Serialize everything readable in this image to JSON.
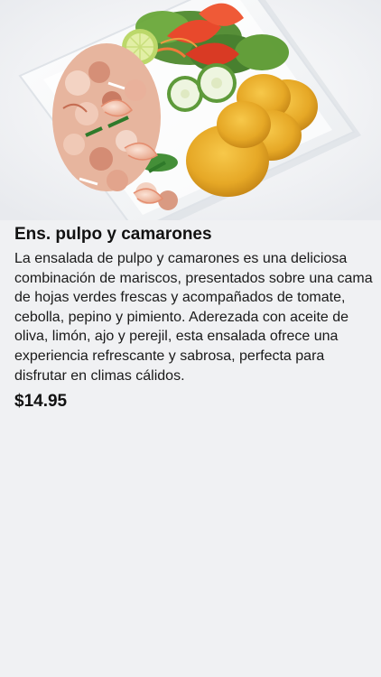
{
  "product": {
    "image_alt": "Ens. pulpo y camarones",
    "title": "Ens. pulpo y camarones",
    "description": "La ensalada de pulpo y camarones es una deliciosa combinación de mariscos, presentados sobre una cama de hojas verdes frescas y acompañados de tomate, cebolla, pepino y pimiento. Aderezada con aceite de oliva, limón, ajo y perejil, esta ensalada ofrece una experiencia refrescante y sabrosa, perfecta para disfrutar en climas cálidos.",
    "price": "$14.95"
  }
}
